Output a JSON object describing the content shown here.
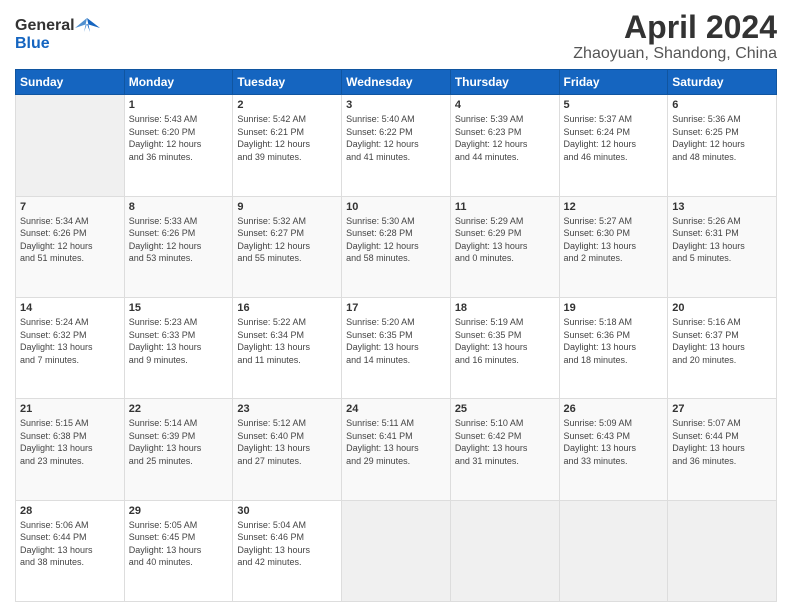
{
  "header": {
    "logo_general": "General",
    "logo_blue": "Blue",
    "title": "April 2024",
    "subtitle": "Zhaoyuan, Shandong, China"
  },
  "calendar": {
    "days_of_week": [
      "Sunday",
      "Monday",
      "Tuesday",
      "Wednesday",
      "Thursday",
      "Friday",
      "Saturday"
    ],
    "weeks": [
      [
        {
          "day": "",
          "info": ""
        },
        {
          "day": "1",
          "info": "Sunrise: 5:43 AM\nSunset: 6:20 PM\nDaylight: 12 hours\nand 36 minutes."
        },
        {
          "day": "2",
          "info": "Sunrise: 5:42 AM\nSunset: 6:21 PM\nDaylight: 12 hours\nand 39 minutes."
        },
        {
          "day": "3",
          "info": "Sunrise: 5:40 AM\nSunset: 6:22 PM\nDaylight: 12 hours\nand 41 minutes."
        },
        {
          "day": "4",
          "info": "Sunrise: 5:39 AM\nSunset: 6:23 PM\nDaylight: 12 hours\nand 44 minutes."
        },
        {
          "day": "5",
          "info": "Sunrise: 5:37 AM\nSunset: 6:24 PM\nDaylight: 12 hours\nand 46 minutes."
        },
        {
          "day": "6",
          "info": "Sunrise: 5:36 AM\nSunset: 6:25 PM\nDaylight: 12 hours\nand 48 minutes."
        }
      ],
      [
        {
          "day": "7",
          "info": "Sunrise: 5:34 AM\nSunset: 6:26 PM\nDaylight: 12 hours\nand 51 minutes."
        },
        {
          "day": "8",
          "info": "Sunrise: 5:33 AM\nSunset: 6:26 PM\nDaylight: 12 hours\nand 53 minutes."
        },
        {
          "day": "9",
          "info": "Sunrise: 5:32 AM\nSunset: 6:27 PM\nDaylight: 12 hours\nand 55 minutes."
        },
        {
          "day": "10",
          "info": "Sunrise: 5:30 AM\nSunset: 6:28 PM\nDaylight: 12 hours\nand 58 minutes."
        },
        {
          "day": "11",
          "info": "Sunrise: 5:29 AM\nSunset: 6:29 PM\nDaylight: 13 hours\nand 0 minutes."
        },
        {
          "day": "12",
          "info": "Sunrise: 5:27 AM\nSunset: 6:30 PM\nDaylight: 13 hours\nand 2 minutes."
        },
        {
          "day": "13",
          "info": "Sunrise: 5:26 AM\nSunset: 6:31 PM\nDaylight: 13 hours\nand 5 minutes."
        }
      ],
      [
        {
          "day": "14",
          "info": "Sunrise: 5:24 AM\nSunset: 6:32 PM\nDaylight: 13 hours\nand 7 minutes."
        },
        {
          "day": "15",
          "info": "Sunrise: 5:23 AM\nSunset: 6:33 PM\nDaylight: 13 hours\nand 9 minutes."
        },
        {
          "day": "16",
          "info": "Sunrise: 5:22 AM\nSunset: 6:34 PM\nDaylight: 13 hours\nand 11 minutes."
        },
        {
          "day": "17",
          "info": "Sunrise: 5:20 AM\nSunset: 6:35 PM\nDaylight: 13 hours\nand 14 minutes."
        },
        {
          "day": "18",
          "info": "Sunrise: 5:19 AM\nSunset: 6:35 PM\nDaylight: 13 hours\nand 16 minutes."
        },
        {
          "day": "19",
          "info": "Sunrise: 5:18 AM\nSunset: 6:36 PM\nDaylight: 13 hours\nand 18 minutes."
        },
        {
          "day": "20",
          "info": "Sunrise: 5:16 AM\nSunset: 6:37 PM\nDaylight: 13 hours\nand 20 minutes."
        }
      ],
      [
        {
          "day": "21",
          "info": "Sunrise: 5:15 AM\nSunset: 6:38 PM\nDaylight: 13 hours\nand 23 minutes."
        },
        {
          "day": "22",
          "info": "Sunrise: 5:14 AM\nSunset: 6:39 PM\nDaylight: 13 hours\nand 25 minutes."
        },
        {
          "day": "23",
          "info": "Sunrise: 5:12 AM\nSunset: 6:40 PM\nDaylight: 13 hours\nand 27 minutes."
        },
        {
          "day": "24",
          "info": "Sunrise: 5:11 AM\nSunset: 6:41 PM\nDaylight: 13 hours\nand 29 minutes."
        },
        {
          "day": "25",
          "info": "Sunrise: 5:10 AM\nSunset: 6:42 PM\nDaylight: 13 hours\nand 31 minutes."
        },
        {
          "day": "26",
          "info": "Sunrise: 5:09 AM\nSunset: 6:43 PM\nDaylight: 13 hours\nand 33 minutes."
        },
        {
          "day": "27",
          "info": "Sunrise: 5:07 AM\nSunset: 6:44 PM\nDaylight: 13 hours\nand 36 minutes."
        }
      ],
      [
        {
          "day": "28",
          "info": "Sunrise: 5:06 AM\nSunset: 6:44 PM\nDaylight: 13 hours\nand 38 minutes."
        },
        {
          "day": "29",
          "info": "Sunrise: 5:05 AM\nSunset: 6:45 PM\nDaylight: 13 hours\nand 40 minutes."
        },
        {
          "day": "30",
          "info": "Sunrise: 5:04 AM\nSunset: 6:46 PM\nDaylight: 13 hours\nand 42 minutes."
        },
        {
          "day": "",
          "info": ""
        },
        {
          "day": "",
          "info": ""
        },
        {
          "day": "",
          "info": ""
        },
        {
          "day": "",
          "info": ""
        }
      ]
    ]
  }
}
